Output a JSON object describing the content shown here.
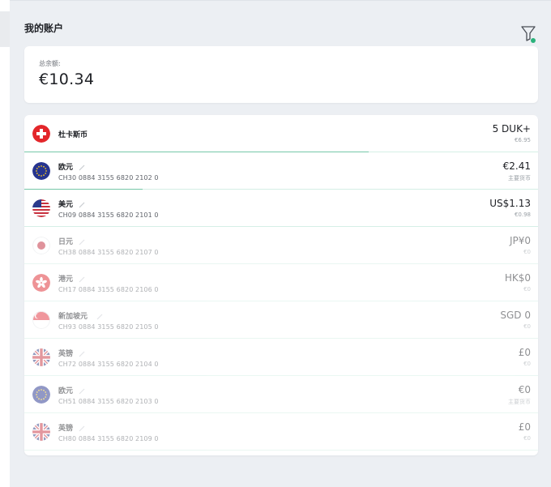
{
  "page": {
    "title": "我的账户"
  },
  "summary": {
    "label": "总余额:",
    "value": "€10.34"
  },
  "colors": {
    "accent_green": "#2ab27b",
    "row_divider": "#d5efe6"
  },
  "accounts": [
    {
      "flag": "switzerland-flag-icon",
      "name": "杜卡斯币",
      "iban": "",
      "amount": "5 DUK+",
      "sub": "€6.95",
      "faded": false,
      "progress": 0.67
    },
    {
      "flag": "eu-flag-icon",
      "name": "欧元",
      "iban": "CH30 0884 3155 6820 2102 0",
      "amount": "€2.41",
      "sub": "主要货币",
      "faded": false,
      "progress": 0.23
    },
    {
      "flag": "us-flag-icon",
      "name": "美元",
      "iban": "CH09 0884 3155 6820 2101 0",
      "amount": "US$1.13",
      "sub": "€0.98",
      "faded": false,
      "progress": 0
    },
    {
      "flag": "japan-flag-icon",
      "name": "日元",
      "iban": "CH38 0884 3155 6820 2107 0",
      "amount": "JP¥0",
      "sub": "€0",
      "faded": true,
      "progress": 0
    },
    {
      "flag": "hongkong-flag-icon",
      "name": "港元",
      "iban": "CH17 0884 3155 6820 2106 0",
      "amount": "HK$0",
      "sub": "€0",
      "faded": true,
      "progress": 0
    },
    {
      "flag": "singapore-flag-icon",
      "name": "新加坡元",
      "iban": "CH93 0884 3155 6820 2105 0",
      "amount": "SGD 0",
      "sub": "€0",
      "faded": true,
      "progress": 0
    },
    {
      "flag": "uk-flag-icon",
      "name": "英镑",
      "iban": "CH72 0884 3155 6820 2104 0",
      "amount": "£0",
      "sub": "€0",
      "faded": true,
      "progress": 0
    },
    {
      "flag": "eu-flag-icon",
      "name": "欧元",
      "iban": "CH51 0884 3155 6820 2103 0",
      "amount": "€0",
      "sub": "主要货币",
      "faded": true,
      "progress": 0
    },
    {
      "flag": "uk-flag-icon",
      "name": "英镑",
      "iban": "CH80 0884 3155 6820 2109 0",
      "amount": "£0",
      "sub": "€0",
      "faded": true,
      "progress": 0
    }
  ]
}
